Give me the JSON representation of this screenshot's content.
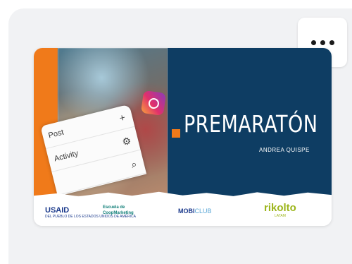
{
  "card": {
    "menu_button": {
      "icon": "more-horizontal-icon"
    },
    "thumbnail": {
      "title": "PREMARATÓN",
      "author": "ANDREA QUISPE",
      "phone_menu": [
        {
          "label": "Post",
          "icon": "plus-icon",
          "glyph": "+"
        },
        {
          "label": "Activity",
          "icon": "gear-icon",
          "glyph": "⚙"
        },
        {
          "label": "",
          "icon": "search-icon",
          "glyph": "⌕"
        }
      ],
      "logos": {
        "usaid": {
          "name": "USAID",
          "tagline": "DEL PUEBLO DE LOS ESTADOS UNIDOS DE AMÉRICA"
        },
        "escuela": {
          "line1": "Escuela de",
          "line2": "CoopMarketing"
        },
        "mobi": {
          "name": "MOBI",
          "suffix": "CLUB"
        },
        "rikolto": {
          "name": "rikolto",
          "tagline": "LATAM"
        }
      },
      "colors": {
        "accent": "#f07a1a",
        "navy": "#0e3d63"
      }
    }
  }
}
